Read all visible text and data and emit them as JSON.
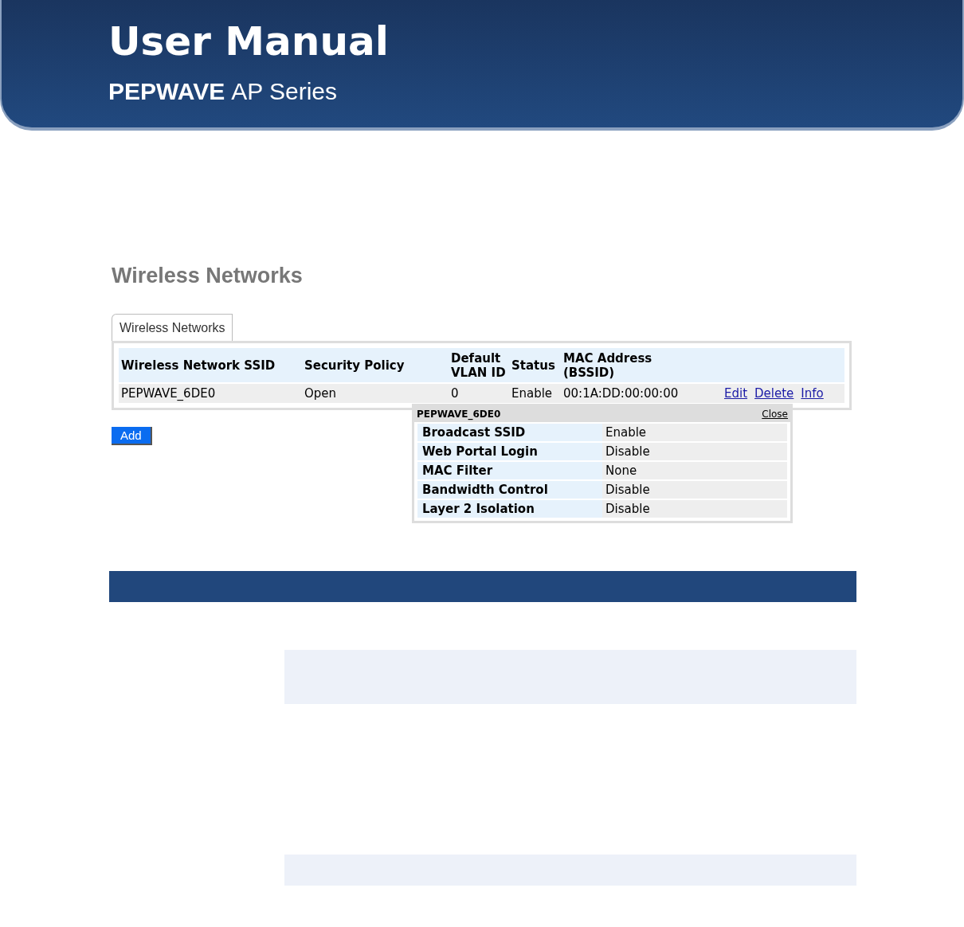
{
  "header": {
    "title": "User Manual",
    "brand": "PEPWAVE",
    "series": "AP Series"
  },
  "page_title": "Wireless Networks",
  "tabs": [
    {
      "label": "Wireless Networks",
      "selected": true
    }
  ],
  "table": {
    "columns": [
      "Wireless Network SSID",
      "Security Policy",
      "Default VLAN ID",
      "Status",
      "MAC Address (BSSID)"
    ],
    "rows": [
      {
        "cells": [
          "PEPWAVE_6DE0",
          "Open",
          "0",
          "Enable",
          "00:1A:DD:00:00:00"
        ],
        "actions": [
          "Edit",
          "Delete",
          "Info"
        ]
      }
    ]
  },
  "add_button": "Add",
  "info_popup": {
    "title": "PEPWAVE_6DE0",
    "close": "Close",
    "rows": [
      {
        "label": "Broadcast SSID",
        "value": "Enable"
      },
      {
        "label": "Web Portal Login",
        "value": "Disable"
      },
      {
        "label": "MAC Filter",
        "value": "None"
      },
      {
        "label": "Bandwidth Control",
        "value": "Disable"
      },
      {
        "label": "Layer 2 Isolation",
        "value": "Disable"
      }
    ]
  }
}
